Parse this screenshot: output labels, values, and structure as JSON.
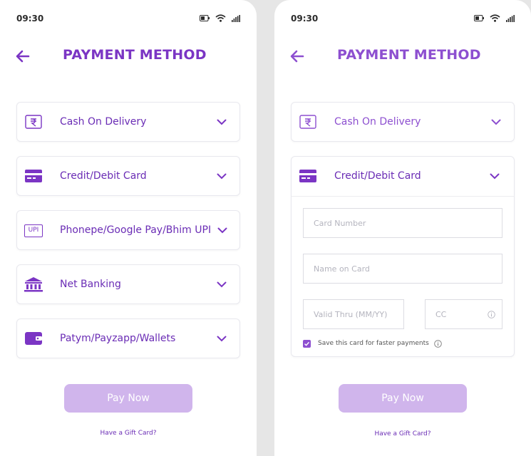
{
  "colors": {
    "accent": "#7b35c4",
    "accent_light": "#d0b5ec",
    "background": "#e6e6e6"
  },
  "status_bar": {
    "time": "09:30",
    "icons": [
      "battery-icon",
      "wifi-icon",
      "signal-icon"
    ]
  },
  "screens": [
    {
      "title": "PAYMENT METHOD",
      "options": [
        {
          "label": "Cash On Delivery",
          "icon": "rupee-icon"
        },
        {
          "label": "Credit/Debit Card",
          "icon": "card-icon"
        },
        {
          "label": "Phonepe/Google Pay/Bhim UPI",
          "icon": "upi-icon",
          "icon_text": "UPI"
        },
        {
          "label": "Net Banking",
          "icon": "bank-icon"
        },
        {
          "label": "Patym/Payzapp/Wallets",
          "icon": "wallet-icon"
        }
      ],
      "pay_button": "Pay Now",
      "gift_link": "Have a Gift Card?"
    },
    {
      "title": "PAYMENT METHOD",
      "options": [
        {
          "label": "Cash On Delivery",
          "icon": "rupee-icon"
        },
        {
          "label": "Credit/Debit Card",
          "icon": "card-icon",
          "expanded": true
        }
      ],
      "card_form": {
        "card_number_placeholder": "Card Number",
        "name_placeholder": "Name on Card",
        "valid_thru_placeholder": "Valid Thru (MM/YY)",
        "cc_placeholder": "CC",
        "save_card_label": "Save this card for faster payments",
        "save_card_checked": true
      },
      "pay_button": "Pay Now",
      "gift_link": "Have a Gift Card?"
    }
  ]
}
